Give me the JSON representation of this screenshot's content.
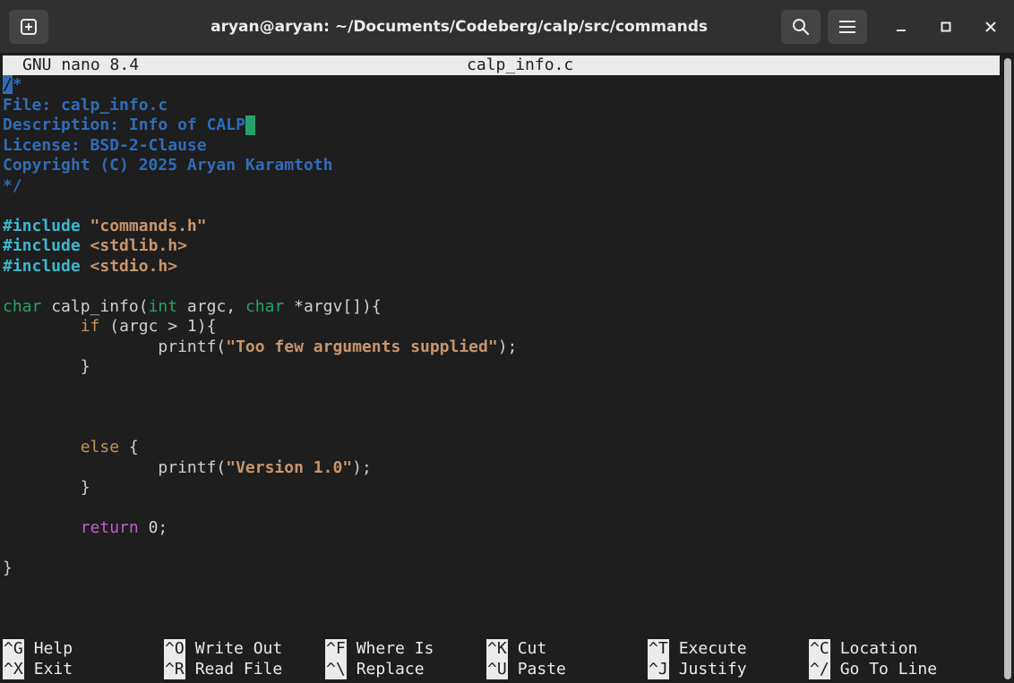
{
  "window": {
    "title": "aryan@aryan: ~/Documents/Codeberg/calp/src/commands"
  },
  "titlebar_icons": {
    "new_tab": "new-tab-icon",
    "search": "search-icon",
    "menu": "hamburger-menu-icon",
    "minimize": "minimize-icon",
    "maximize": "maximize-icon",
    "close": "close-icon"
  },
  "nano": {
    "version": "GNU nano 8.4",
    "filename": "calp_info.c"
  },
  "code": {
    "l1_sel": "/",
    "l1_rest": "*",
    "l2": "File: calp_info.c",
    "l3": "Description: Info of CALP",
    "l4": "License: BSD-2-Clause",
    "l5": "Copyright (C) 2025 Aryan Karamtoth",
    "l6": "*/",
    "inc1_kw": "#include",
    "inc1_val": "\"commands.h\"",
    "inc2_kw": "#include",
    "inc2_val": "<stdlib.h>",
    "inc3_kw": "#include",
    "inc3_val": "<stdio.h>",
    "fn_type": "char",
    "fn_name": " calp_info(",
    "fn_int": "int",
    "fn_argc": " argc, ",
    "fn_char": "char",
    "fn_argv": " *argv[]){",
    "if_kw": "if",
    "if_cond": " (argc > 1){",
    "printf1": "printf(",
    "str1": "\"Too few arguments supplied\"",
    "printf1_end": ");",
    "close_brace1": "}",
    "else_kw": "else",
    "else_rest": " {",
    "printf2": "printf(",
    "str2": "\"Version 1.0\"",
    "printf2_end": ");",
    "close_brace2": "}",
    "return_kw": "return",
    "return_rest": " 0;",
    "close_brace3": "}"
  },
  "shortcuts": [
    {
      "key": "^G",
      "label": "Help"
    },
    {
      "key": "^O",
      "label": "Write Out"
    },
    {
      "key": "^F",
      "label": "Where Is"
    },
    {
      "key": "^K",
      "label": "Cut"
    },
    {
      "key": "^T",
      "label": "Execute"
    },
    {
      "key": "^C",
      "label": "Location"
    },
    {
      "key": "^X",
      "label": "Exit"
    },
    {
      "key": "^R",
      "label": "Read File"
    },
    {
      "key": "^\\",
      "label": "Replace"
    },
    {
      "key": "^U",
      "label": "Paste"
    },
    {
      "key": "^J",
      "label": "Justify"
    },
    {
      "key": "^/",
      "label": "Go To Line"
    }
  ],
  "colors": {
    "comment": "#2f6cb8",
    "preprocessor": "#3cb8d0",
    "string": "#c8956c",
    "type_keyword": "#26a269",
    "control_keyword": "#c0955e",
    "return_keyword": "#c061cb",
    "cursor": "#26a269"
  }
}
